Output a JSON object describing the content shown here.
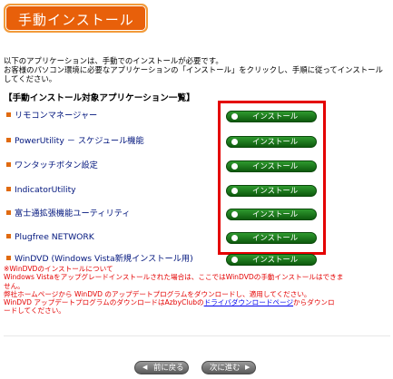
{
  "title": "手動インストール",
  "intro": [
    "以下のアプリケーションは、手動でのインストールが必要です。",
    "お客様のパソコン環境に必要なアプリケーションの「インストール」をクリックし、手順に従ってインストール",
    "してください。"
  ],
  "section_heading": "【手動インストール対象アプリケーション一覧】",
  "install_label": "インストール",
  "apps": [
    {
      "name": "リモコンマネージャー"
    },
    {
      "name": "PowerUtility － スケジュール機能"
    },
    {
      "name": "ワンタッチボタン設定"
    },
    {
      "name": "IndicatorUtility"
    },
    {
      "name": "富士通拡張機能ユーティリティ"
    },
    {
      "name": "Plugfree NETWORK"
    },
    {
      "name": "WinDVD (Windows Vista新規インストール用)"
    }
  ],
  "notes": {
    "line1": "※WinDVDのインストールについて",
    "line2": "Windows Vistaをアップグレードインストールされた場合は、ここではWinDVDの手動インストールはできま",
    "line3": "せん。",
    "line4": "弊社ホームページから WinDVD のアップデートプログラムをダウンロードし、適用してください。",
    "line5_pre": "WinDVD アップデートプログラムのダウンロードはAzbyClubの",
    "line5_link": "ドライバダウンロードページ",
    "line5_post": "からダウンロ",
    "line6": "ードしてください。"
  },
  "nav": {
    "back_arrow": "◀",
    "back": "前に戻る",
    "next": "次に進む",
    "next_arrow": "▶"
  }
}
